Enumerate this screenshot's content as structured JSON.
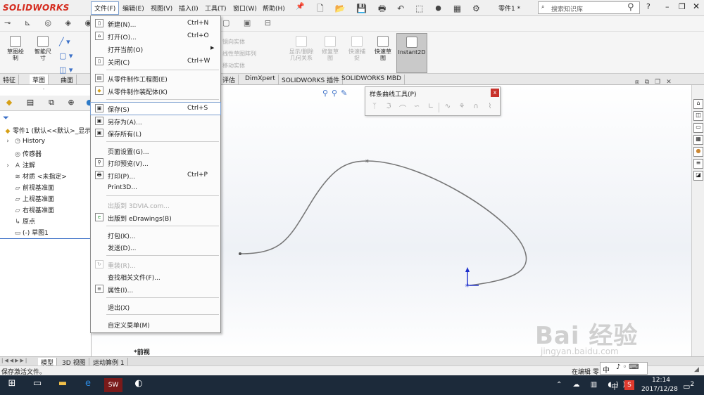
{
  "app": {
    "logo": "SOLIDWORKS",
    "doc_title": "零件1 *",
    "search_placeholder": "搜索知识库"
  },
  "menubar": [
    {
      "label": "文件(F)"
    },
    {
      "label": "编辑(E)"
    },
    {
      "label": "视图(V)"
    },
    {
      "label": "插入(I)"
    },
    {
      "label": "工具(T)"
    },
    {
      "label": "窗口(W)"
    },
    {
      "label": "帮助(H)"
    }
  ],
  "ribbon": {
    "sketch_btn": "草图绘\n制",
    "smart_dim": "智能尺\n寸",
    "mirror": "镜向实体",
    "linear_pattern": "线性草图阵列",
    "move": "移动实体",
    "show_delete": "显示/删除\n几何关系",
    "repair": "修复草\n图",
    "quick_snap": "快速捕\n捉",
    "rapid_sketch": "快速草\n图",
    "instant2d": "Instant2D"
  },
  "tabs": [
    {
      "label": "特征"
    },
    {
      "label": "草图"
    },
    {
      "label": "曲面"
    },
    {
      "label": "评估"
    },
    {
      "label": "DimXpert"
    },
    {
      "label": "SOLIDWORKS 插件"
    },
    {
      "label": "SOLIDWORKS MBD"
    }
  ],
  "tree": {
    "root": "零件1 (默认<<默认>_显示",
    "items": [
      {
        "label": "History"
      },
      {
        "label": "传感器"
      },
      {
        "label": "注解"
      },
      {
        "label": "材质 <未指定>"
      },
      {
        "label": "前视基准面"
      },
      {
        "label": "上视基准面"
      },
      {
        "label": "右视基准面"
      },
      {
        "label": "原点"
      },
      {
        "label": "(-) 草图1"
      }
    ]
  },
  "file_menu": {
    "new": {
      "label": "新建(N)...",
      "shortcut": "Ctrl+N"
    },
    "open": {
      "label": "打开(O)...",
      "shortcut": "Ctrl+O"
    },
    "open_current": {
      "label": "打开当前(O)"
    },
    "close": {
      "label": "关闭(C)",
      "shortcut": "Ctrl+W"
    },
    "make_drawing": {
      "label": "从零件制作工程图(E)"
    },
    "make_assembly": {
      "label": "从零件制作装配体(K)"
    },
    "save": {
      "label": "保存(S)",
      "shortcut": "Ctrl+S"
    },
    "save_as": {
      "label": "另存为(A)..."
    },
    "save_all": {
      "label": "保存所有(L)"
    },
    "page_setup": {
      "label": "页面设置(G)..."
    },
    "print_preview": {
      "label": "打印预览(V)..."
    },
    "print": {
      "label": "打印(P)...",
      "shortcut": "Ctrl+P"
    },
    "print3d": {
      "label": "Print3D..."
    },
    "publish_3dvia": {
      "label": "出版到 3DVIA.com..."
    },
    "publish_edrawings": {
      "label": "出版到 eDrawings(B)"
    },
    "pack_go": {
      "label": "打包(K)..."
    },
    "send": {
      "label": "发送(D)..."
    },
    "reload": {
      "label": "重装(R)..."
    },
    "find_refs": {
      "label": "查找相关文件(F)..."
    },
    "properties": {
      "label": "属性(I)..."
    },
    "exit": {
      "label": "退出(X)"
    },
    "customize": {
      "label": "自定义菜单(M)"
    }
  },
  "spline_toolbar": {
    "title": "样条曲线工具(P)",
    "close": "x"
  },
  "viewport": {
    "view_label": "*前视"
  },
  "bottom_tabs": [
    {
      "label": "模型"
    },
    {
      "label": "3D 视图"
    },
    {
      "label": "运动算例 1"
    }
  ],
  "status": {
    "text": "保存激活文件。",
    "right_text": "在编辑 零"
  },
  "taskbar": {
    "time": "12:14",
    "date": "2017/12/28",
    "ime": "中",
    "notif": "2",
    "ime_float": "中"
  },
  "watermark": {
    "big": "Bai 经验",
    "small": "jingyan.baidu.com"
  }
}
